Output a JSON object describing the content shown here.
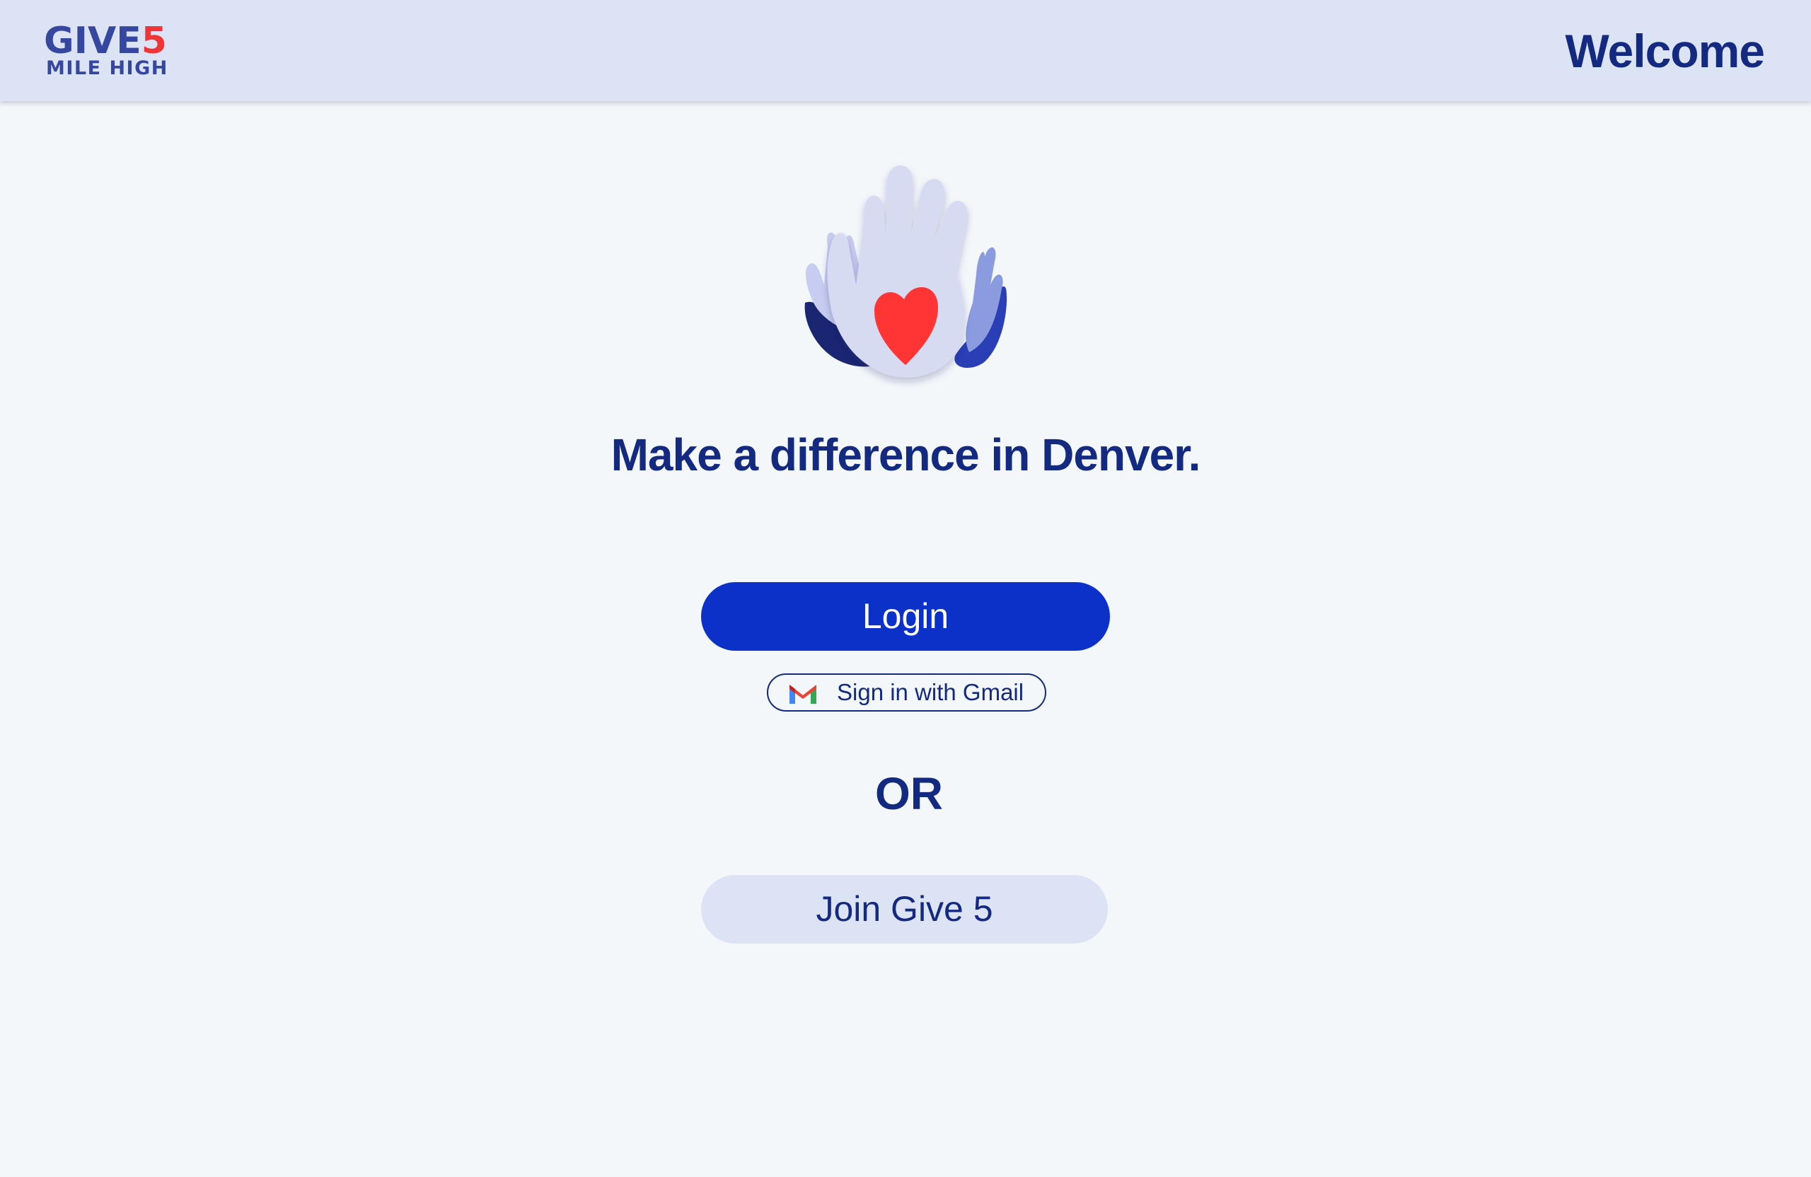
{
  "header": {
    "logo": {
      "word": "GIVE",
      "number": "5",
      "subtitle": "MILE HIGH"
    },
    "title": "Welcome"
  },
  "hero": {
    "illustration": "hands-heart-icon",
    "tagline": "Make a difference in Denver."
  },
  "auth": {
    "login_label": "Login",
    "gmail_label": "Sign in with Gmail",
    "gmail_icon": "gmail-icon",
    "divider_text": "OR",
    "join_label": "Join Give 5"
  },
  "colors": {
    "page_background": "#f3f7fa",
    "header_background": "#dce3f5",
    "primary_navy": "#142a80",
    "login_blue": "#0c31c9",
    "logo_blue": "#3647a0",
    "logo_red": "#ef3535",
    "heart_red": "#ff3535",
    "join_background": "#dce3f5"
  }
}
